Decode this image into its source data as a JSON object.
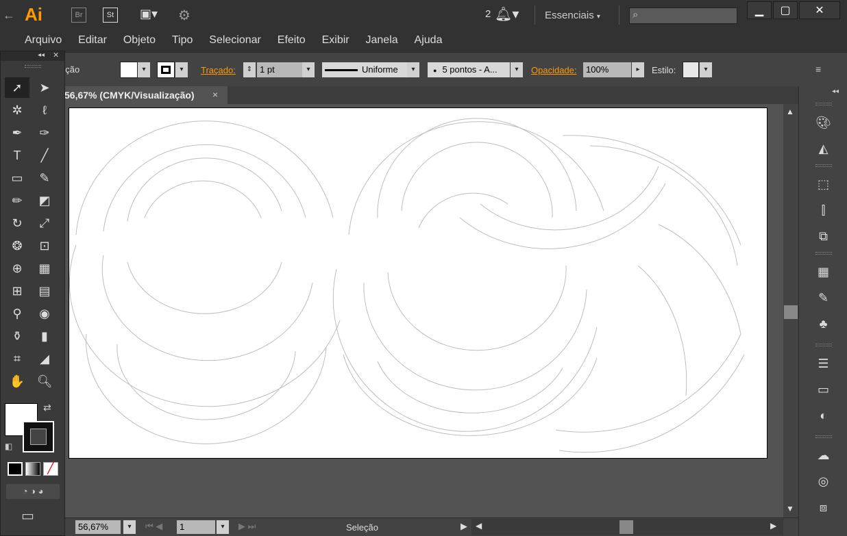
{
  "app": {
    "logo": "Ai",
    "br": "Br",
    "st": "St",
    "notif_count": "2",
    "workspace": "Essenciais",
    "search_placeholder": ""
  },
  "menu": [
    "Arquivo",
    "Editar",
    "Objeto",
    "Tipo",
    "Selecionar",
    "Efeito",
    "Exibir",
    "Janela",
    "Ajuda"
  ],
  "control": {
    "selection_label": "eção",
    "stroke_label": "Traçado:",
    "stroke_value": "1 pt",
    "profile": "Uniforme",
    "brush": "5 pontos - A...",
    "opacity_label": "Opacidade:",
    "opacity_value": "100%",
    "style_label": "Estilo:"
  },
  "tab": {
    "title": "56,67% (CMYK/Visualização)",
    "close": "×"
  },
  "status": {
    "zoom": "56,67%",
    "page": "1",
    "mode": "Seleção"
  },
  "colors": {
    "accent": "#ff9a00",
    "bg": "#535353",
    "panel": "#434343",
    "dark": "#323232"
  },
  "icons": {
    "tools": [
      "selection-tool",
      "direct-selection-tool",
      "magic-wand-tool",
      "lasso-tool",
      "pen-tool",
      "curvature-tool",
      "type-tool",
      "line-tool",
      "rectangle-tool",
      "paintbrush-tool",
      "pencil-tool",
      "eraser-tool",
      "rotate-tool",
      "scale-tool",
      "warp-tool",
      "free-transform-tool",
      "shape-builder-tool",
      "perspective-grid-tool",
      "mesh-tool",
      "gradient-tool",
      "eyedropper-tool",
      "blend-tool",
      "symbol-sprayer-tool",
      "column-graph-tool",
      "artboard-tool",
      "slice-tool",
      "hand-tool",
      "zoom-tool"
    ],
    "panels": [
      "color-panel-icon",
      "color-guide-icon",
      "transform-icon",
      "align-icon",
      "pathfinder-icon",
      "swatches-icon",
      "brushes-icon",
      "symbols-icon",
      "stroke-icon",
      "gradient-icon",
      "transparency-icon",
      "libraries-icon",
      "appearance-icon",
      "layers-icon"
    ]
  }
}
